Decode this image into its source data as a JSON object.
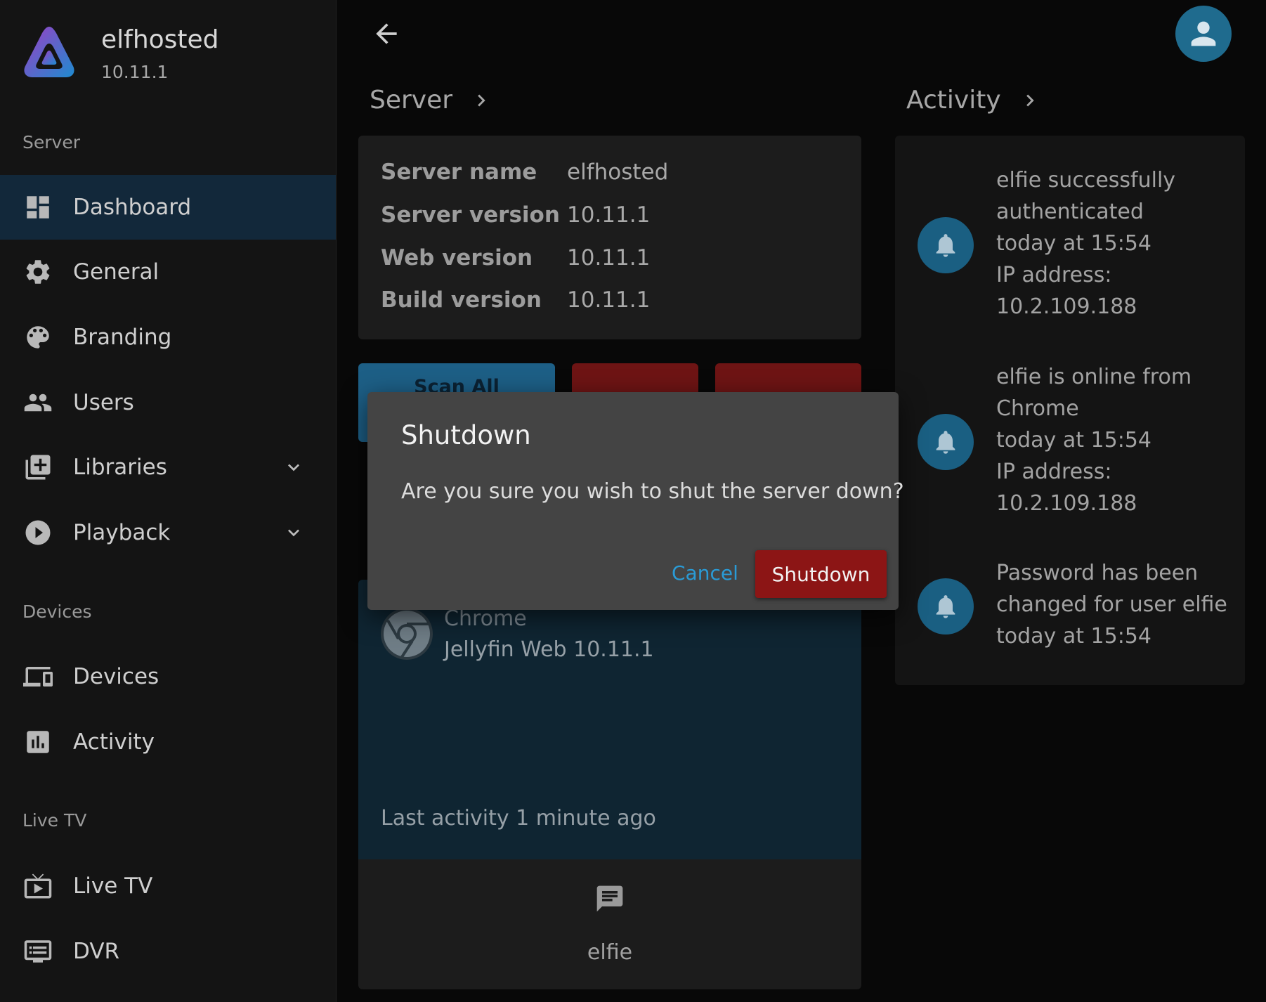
{
  "brand": {
    "name": "elfhosted",
    "version": "10.11.1"
  },
  "sidebar": {
    "sections": [
      {
        "label": "Server"
      },
      {
        "label": "Devices"
      },
      {
        "label": "Live TV"
      }
    ],
    "items": [
      {
        "label": "Dashboard",
        "icon": "dashboard-icon",
        "active": true
      },
      {
        "label": "General",
        "icon": "gear-icon"
      },
      {
        "label": "Branding",
        "icon": "palette-icon"
      },
      {
        "label": "Users",
        "icon": "people-icon"
      },
      {
        "label": "Libraries",
        "icon": "library-add-icon",
        "expandable": true
      },
      {
        "label": "Playback",
        "icon": "play-circle-icon",
        "expandable": true
      },
      {
        "label": "Devices",
        "icon": "devices-icon"
      },
      {
        "label": "Activity",
        "icon": "bar-chart-icon"
      },
      {
        "label": "Live TV",
        "icon": "live-tv-icon"
      },
      {
        "label": "DVR",
        "icon": "dvr-icon"
      }
    ]
  },
  "main": {
    "server_title": "Server",
    "activity_title": "Activity",
    "server_info": [
      {
        "key": "Server name",
        "value": "elfhosted"
      },
      {
        "key": "Server version",
        "value": "10.11.1"
      },
      {
        "key": "Web version",
        "value": "10.11.1"
      },
      {
        "key": "Build version",
        "value": "10.11.1"
      }
    ],
    "actions": {
      "scan_label": "Scan All"
    },
    "session": {
      "client": "Chrome",
      "app": "Jellyfin Web 10.11.1",
      "last_activity": "Last activity 1 minute ago",
      "user": "elfie"
    },
    "activity": [
      {
        "lines": [
          "elfie successfully",
          "authenticated",
          "today at 15:54",
          "IP address:",
          "10.2.109.188"
        ]
      },
      {
        "lines": [
          "elfie is online from",
          "Chrome",
          "today at 15:54",
          "IP address:",
          "10.2.109.188"
        ]
      },
      {
        "lines": [
          "Password has been",
          "changed for user elfie",
          "today at 15:54"
        ]
      }
    ]
  },
  "dialog": {
    "title": "Shutdown",
    "message": "Are you sure you wish to shut the server down?",
    "cancel_label": "Cancel",
    "confirm_label": "Shutdown"
  },
  "colors": {
    "accent": "#1f6b8e",
    "danger": "#8c1515",
    "link": "#2a9bd6"
  }
}
